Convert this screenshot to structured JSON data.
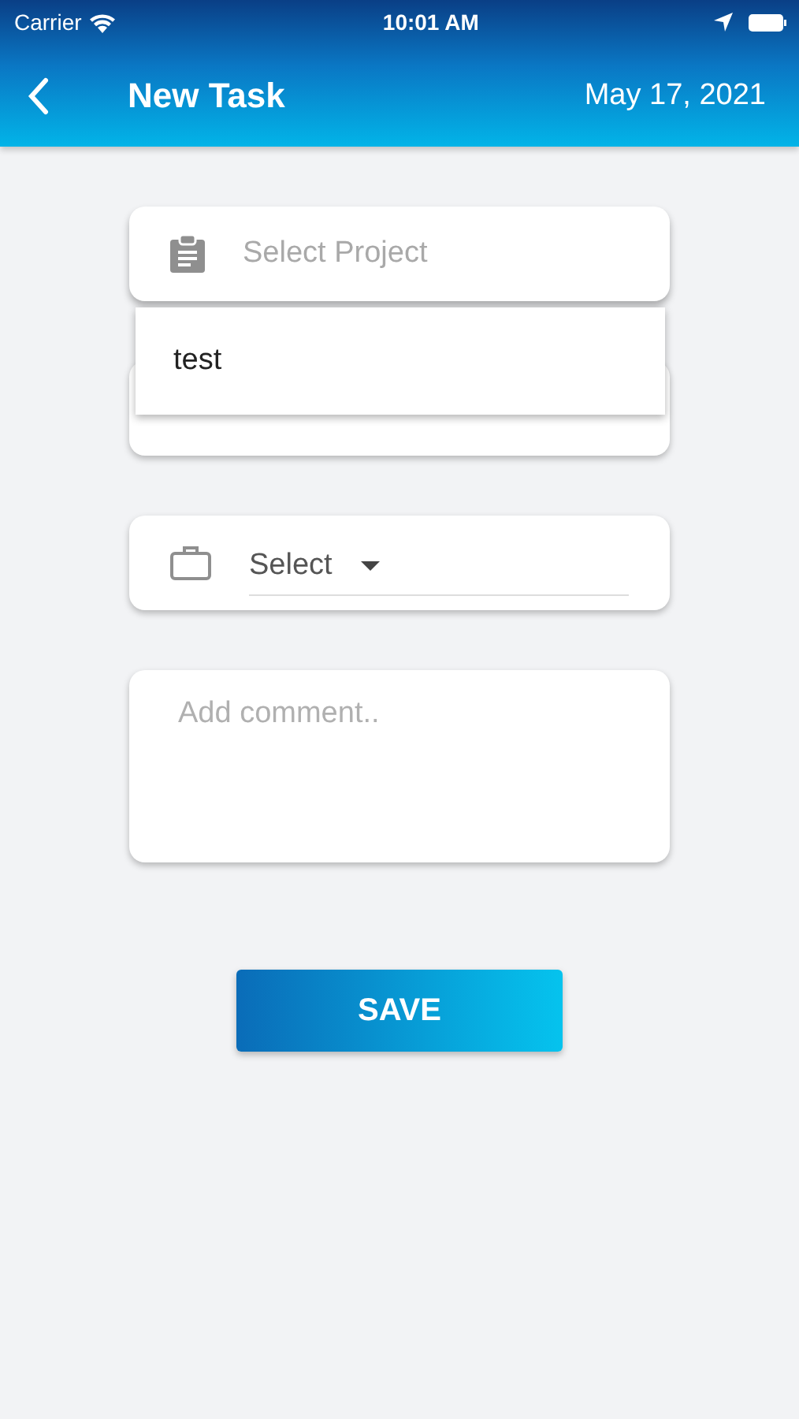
{
  "status_bar": {
    "carrier": "Carrier",
    "time": "10:01 AM"
  },
  "header": {
    "title": "New Task",
    "date": "May 17, 2021"
  },
  "project_field": {
    "placeholder": "Select Project",
    "expanded": true,
    "options": [
      "test"
    ]
  },
  "category_field": {
    "value": "Select"
  },
  "comment_field": {
    "placeholder": "Add comment.."
  },
  "save_button": "SAVE"
}
